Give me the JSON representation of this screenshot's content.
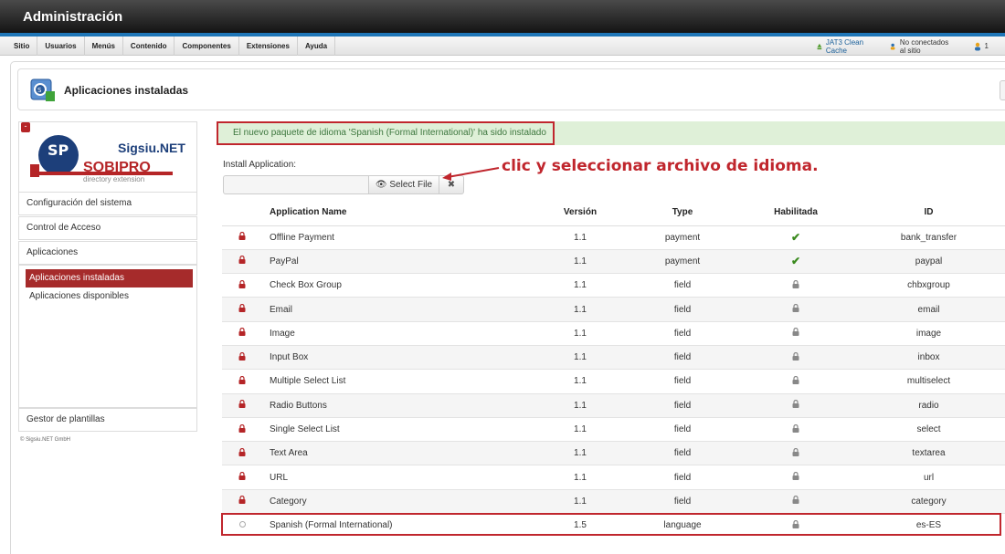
{
  "header": {
    "title": "Administración"
  },
  "menu": {
    "items": [
      "Sitio",
      "Usuarios",
      "Menús",
      "Contenido",
      "Componentes",
      "Extensiones",
      "Ayuda"
    ]
  },
  "status": {
    "cache": "JAT3 Clean Cache",
    "visitors": "No conectados al sitio",
    "count": "1"
  },
  "toolbar": {
    "title": "Aplicaciones instaladas"
  },
  "logo": {
    "brand_top": "Sigsiu.NET",
    "brand_main": "SOBIPRO",
    "brand_sub": "directory extension",
    "badge": "SP"
  },
  "sidebar": {
    "config": "Configuración del sistema",
    "access": "Control de Acceso",
    "apps": "Aplicaciones",
    "sub_active": "Aplicaciones instaladas",
    "sub_other": "Aplicaciones disponibles",
    "templates": "Gestor de plantillas",
    "copyright": "© Sigsiu.NET GmbH"
  },
  "message": "El nuevo paquete de idioma 'Spanish (Formal International)' ha sido instalado",
  "install": {
    "label": "Install Application:",
    "select_file": "Select File",
    "clear": "✖"
  },
  "annotation": "clic y seleccionar archivo de idioma.",
  "table": {
    "headers": {
      "name": "Application Name",
      "version": "Versión",
      "type": "Type",
      "enabled": "Habilitada",
      "id": "ID"
    },
    "rows": [
      {
        "name": "Offline Payment",
        "version": "1.1",
        "type": "payment",
        "enabled": "check",
        "id": "bank_transfer"
      },
      {
        "name": "PayPal",
        "version": "1.1",
        "type": "payment",
        "enabled": "check",
        "id": "paypal"
      },
      {
        "name": "Check Box Group",
        "version": "1.1",
        "type": "field",
        "enabled": "lock",
        "id": "chbxgroup"
      },
      {
        "name": "Email",
        "version": "1.1",
        "type": "field",
        "enabled": "lock",
        "id": "email"
      },
      {
        "name": "Image",
        "version": "1.1",
        "type": "field",
        "enabled": "lock",
        "id": "image"
      },
      {
        "name": "Input Box",
        "version": "1.1",
        "type": "field",
        "enabled": "lock",
        "id": "inbox"
      },
      {
        "name": "Multiple Select List",
        "version": "1.1",
        "type": "field",
        "enabled": "lock",
        "id": "multiselect"
      },
      {
        "name": "Radio Buttons",
        "version": "1.1",
        "type": "field",
        "enabled": "lock",
        "id": "radio"
      },
      {
        "name": "Single Select List",
        "version": "1.1",
        "type": "field",
        "enabled": "lock",
        "id": "select"
      },
      {
        "name": "Text Area",
        "version": "1.1",
        "type": "field",
        "enabled": "lock",
        "id": "textarea"
      },
      {
        "name": "URL",
        "version": "1.1",
        "type": "field",
        "enabled": "lock",
        "id": "url"
      },
      {
        "name": "Category",
        "version": "1.1",
        "type": "field",
        "enabled": "lock",
        "id": "category"
      },
      {
        "name": "Spanish (Formal International)",
        "version": "1.5",
        "type": "language",
        "enabled": "lock",
        "id": "es-ES",
        "removable": true
      }
    ]
  },
  "colors": {
    "accent": "#c0262d",
    "header_blue": "#1f76b7",
    "success_bg": "#dff0d8",
    "success_text": "#3c763d"
  }
}
